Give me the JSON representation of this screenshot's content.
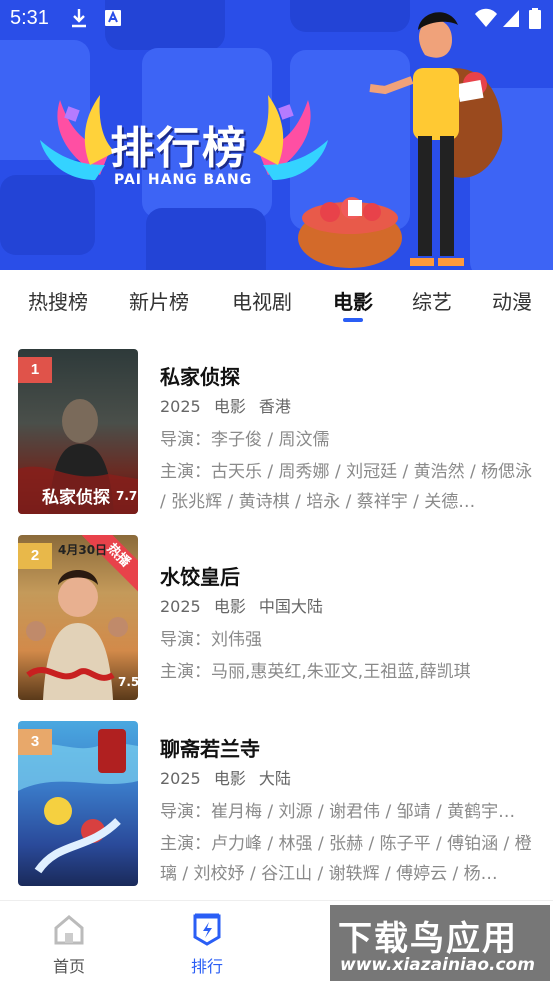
{
  "status_bar": {
    "time": "5:31"
  },
  "banner": {
    "title": "排行榜",
    "subtitle": "PAI HANG BANG"
  },
  "tabs": [
    {
      "label": "热搜榜",
      "active": false
    },
    {
      "label": "新片榜",
      "active": false
    },
    {
      "label": "电视剧",
      "active": false
    },
    {
      "label": "电影",
      "active": true
    },
    {
      "label": "综艺",
      "active": false
    },
    {
      "label": "动漫",
      "active": false
    }
  ],
  "movies": [
    {
      "rank": "1",
      "title": "私家侦探",
      "year": "2025",
      "type": "电影",
      "region": "香港",
      "director": "导演：李子俊 / 周汶儒",
      "cast": "主演：古天乐 / 周秀娜 / 刘冠廷 / 黄浩然 / 杨偲泳 / 张兆辉 / 黄诗棋 / 培永 / 蔡祥宇 / 关德…",
      "poster_title": "私家侦探",
      "poster_score": "7.7"
    },
    {
      "rank": "2",
      "title": "水饺皇后",
      "year": "2025",
      "type": "电影",
      "region": "中国大陆",
      "director": "导演：刘伟强",
      "cast": "主演：马丽,惠英红,朱亚文,王祖蓝,薛凯琪",
      "hot_badge": "热播",
      "poster_date": "4月30日",
      "poster_score": "7.5"
    },
    {
      "rank": "3",
      "title": "聊斋若兰寺",
      "year": "2025",
      "type": "电影",
      "region": "大陆",
      "director": "导演：崔月梅 / 刘源 / 谢君伟 / 邹靖 / 黄鹤宇…",
      "cast": "主演：卢力峰 / 林强 / 张赫 / 陈子平 / 傅铂涵 / 橙璃 / 刘校妤 / 谷江山 / 谢轶辉 / 傅婷云 / 杨…"
    }
  ],
  "bottom_nav": [
    {
      "label": "首页",
      "icon": "home-icon",
      "active": false
    },
    {
      "label": "排行",
      "icon": "ranking-icon",
      "active": true
    }
  ],
  "watermark": {
    "text": "下载鸟应用",
    "url": "www.xiazainiao.com"
  },
  "colors": {
    "accent": "#2a5ef5",
    "banner": "#2a4ee8",
    "rank1": "#e0534a",
    "rank2": "#e8b84a",
    "rank3": "#e8a86a"
  }
}
